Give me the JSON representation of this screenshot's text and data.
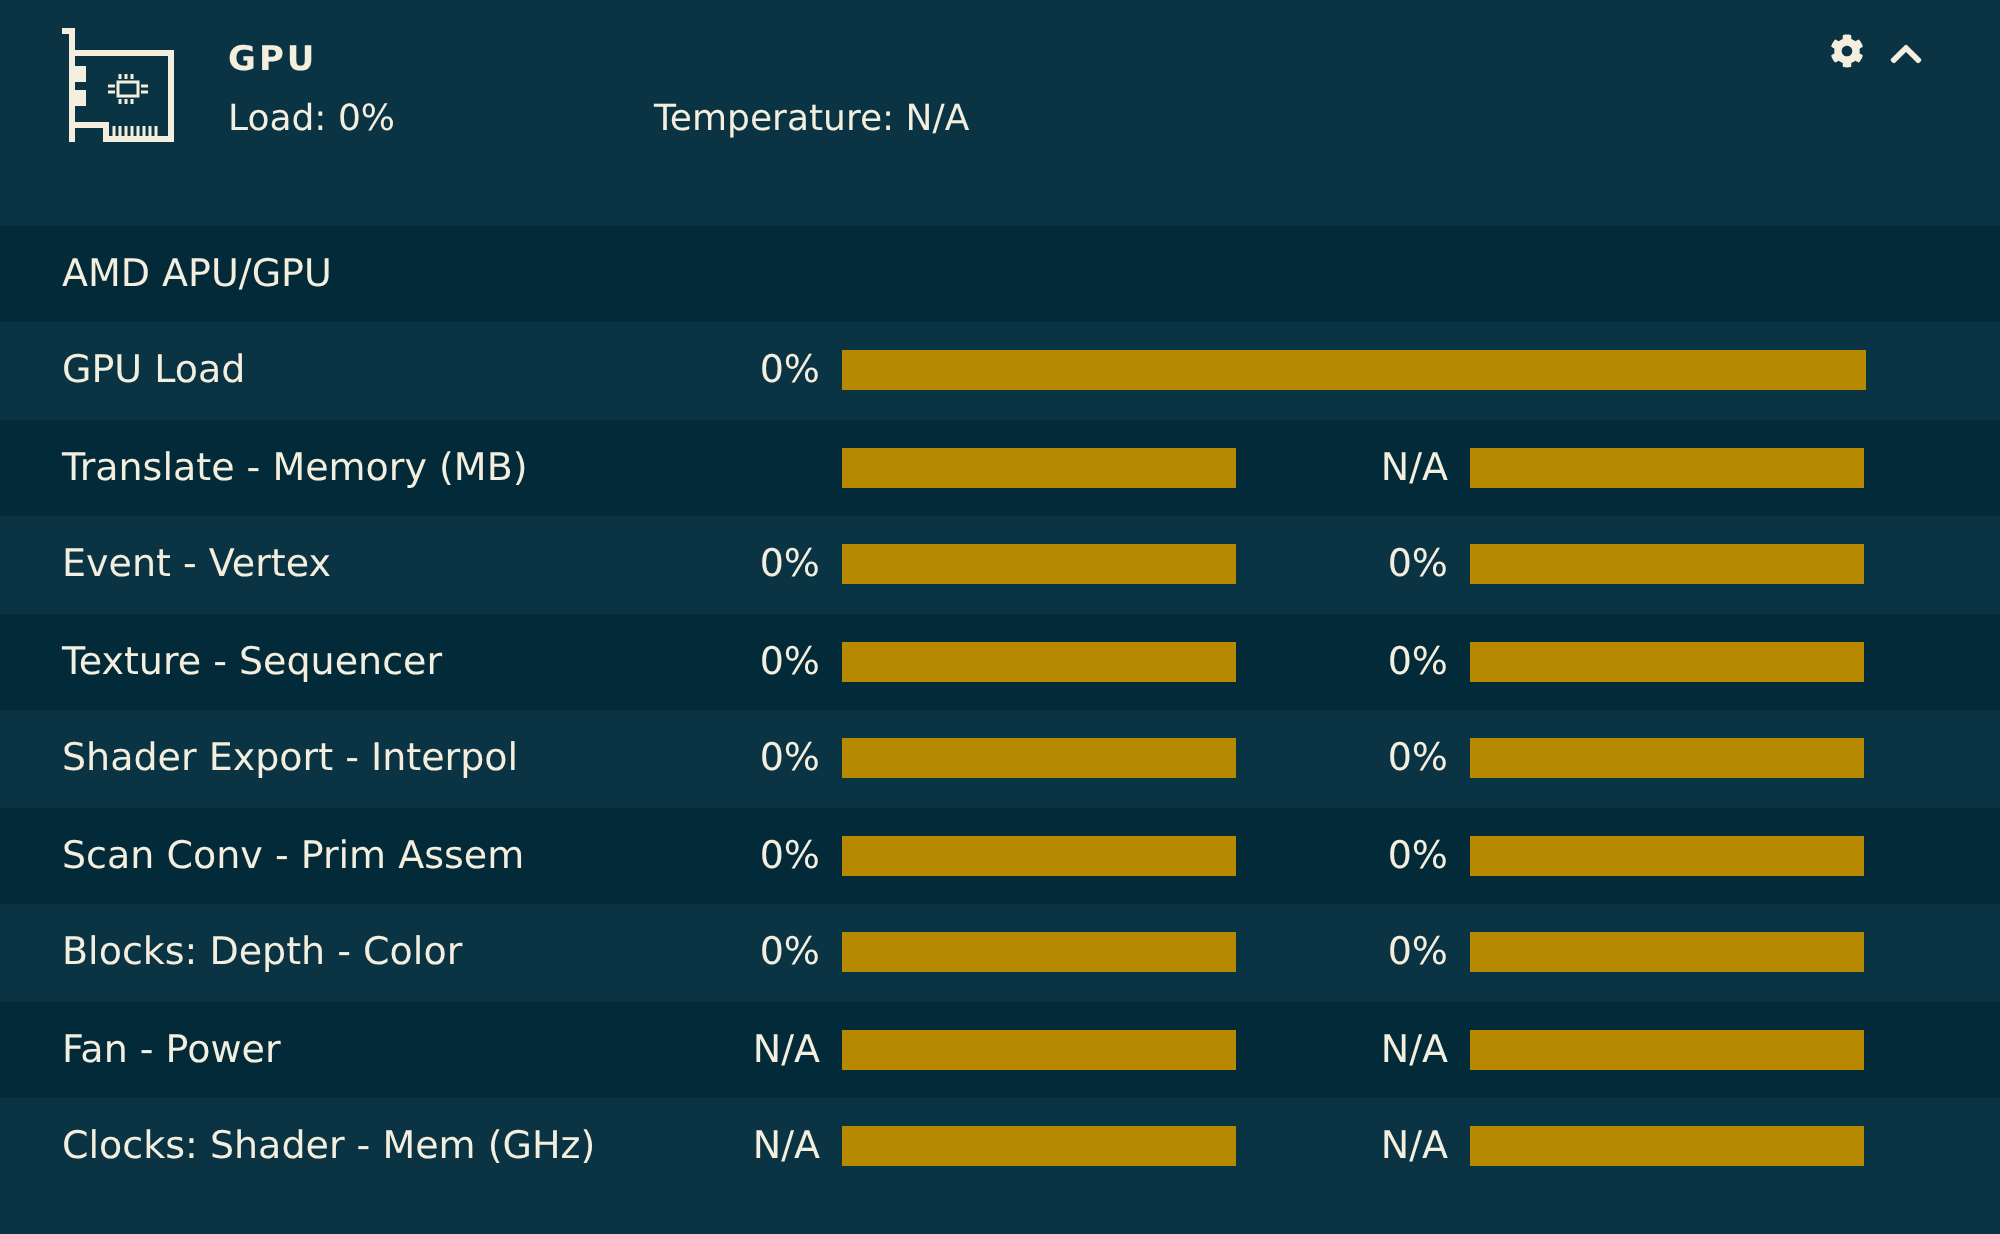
{
  "panel": {
    "title": "GPU",
    "load": "Load: 0%",
    "temperature": "Temperature: N/A"
  },
  "group": {
    "title": "AMD APU/GPU",
    "rows": [
      {
        "label": "GPU Load",
        "kind": "single",
        "left_reading": "0%"
      },
      {
        "label": "Translate - Memory (MB)",
        "kind": "dual",
        "right_reading": "N/A"
      },
      {
        "label": "Event - Vertex",
        "kind": "dual",
        "left_reading": "0%",
        "right_reading": "0%"
      },
      {
        "label": "Texture - Sequencer",
        "kind": "dual",
        "left_reading": "0%",
        "right_reading": "0%"
      },
      {
        "label": "Shader Export - Interpol",
        "kind": "dual",
        "left_reading": "0%",
        "right_reading": "0%"
      },
      {
        "label": "Scan Conv - Prim Assem",
        "kind": "dual",
        "left_reading": "0%",
        "right_reading": "0%"
      },
      {
        "label": "Blocks: Depth - Color",
        "kind": "dual",
        "left_reading": "0%",
        "right_reading": "0%"
      },
      {
        "label": "Fan - Power",
        "kind": "dual",
        "left_reading": "N/A",
        "right_reading": "N/A"
      },
      {
        "label": "Clocks: Shader - Mem (GHz)",
        "kind": "dual",
        "left_reading": "N/A",
        "right_reading": "N/A"
      }
    ]
  }
}
